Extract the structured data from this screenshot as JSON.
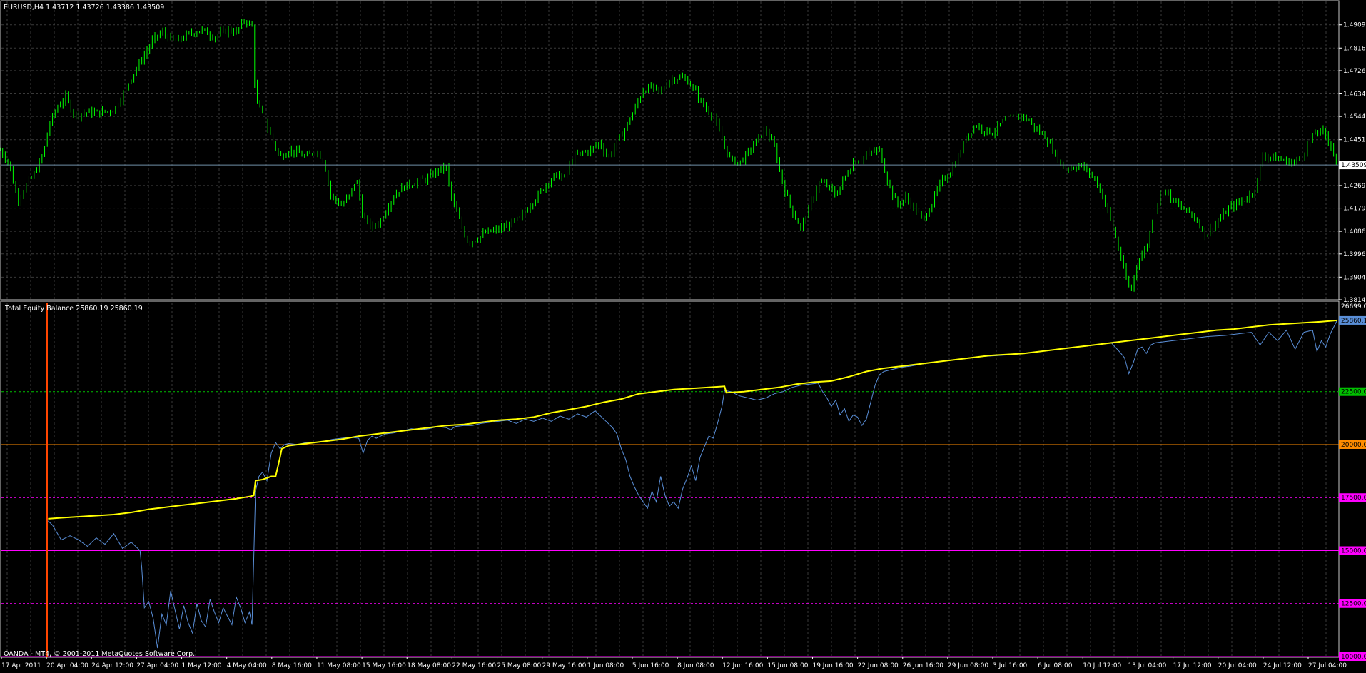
{
  "window": {
    "symbol_header": "EURUSD,H4  1.43712 1.43726 1.43386 1.43509",
    "indicator_header": "Total Equity Balance 25860.19 25860.19",
    "copyright": "OANDA - MT4, © 2001-2011 MetaQuotes Software Corp."
  },
  "colors": {
    "background": "#000000",
    "grid": "#3a3a3a",
    "candle": "#00ff00",
    "balance": "#ffff00",
    "equity": "#5a8fd8",
    "level_20000": "#ff8c00",
    "level_pink": "#ff00ff",
    "level_22500": "#00c000",
    "time_marker": "#ff4500",
    "current_price_line": "#6f8fa8"
  },
  "price_axis": {
    "ticks": [
      "1.49090",
      "1.48165",
      "1.47265",
      "1.46340",
      "1.45440",
      "1.44515",
      "1.42690",
      "1.41790",
      "1.40865",
      "1.39965",
      "1.39040",
      "1.38140"
    ],
    "current_price": "1.43509"
  },
  "indicator_axis": {
    "top_label": "26699.09",
    "ticks": [
      "25860.1",
      "22500.0",
      "20000.0",
      "17500.0",
      "15000.0",
      "12500.0",
      "10000.0"
    ]
  },
  "time_axis": {
    "labels": [
      "17 Apr 2011",
      "20 Apr 04:00",
      "24 Apr 12:00",
      "27 Apr 04:00",
      "1 May 12:00",
      "4 May 04:00",
      "8 May 16:00",
      "11 May 08:00",
      "15 May 16:00",
      "18 May 08:00",
      "22 May 16:00",
      "25 May 08:00",
      "29 May 16:00",
      "1 Jun 08:00",
      "5 Jun 16:00",
      "8 Jun 08:00",
      "12 Jun 16:00",
      "15 Jun 08:00",
      "19 Jun 16:00",
      "22 Jun 08:00",
      "26 Jun 16:00",
      "29 Jun 08:00",
      "3 Jul 16:00",
      "6 Jul 08:00",
      "10 Jul 12:00",
      "13 Jul 04:00",
      "17 Jul 12:00",
      "20 Jul 04:00",
      "24 Jul 12:00",
      "27 Jul 04:00"
    ]
  },
  "chart_data": [
    {
      "type": "candlestick",
      "title": "EURUSD,H4",
      "ylim": [
        1.3814,
        1.5002
      ],
      "price_path_keyframes": [
        [
          0,
          1.441
        ],
        [
          10,
          1.436
        ],
        [
          20,
          1.421
        ],
        [
          30,
          1.427
        ],
        [
          40,
          1.432
        ],
        [
          50,
          1.44
        ],
        [
          55,
          1.45
        ],
        [
          65,
          1.458
        ],
        [
          75,
          1.462
        ],
        [
          85,
          1.455
        ],
        [
          100,
          1.456
        ],
        [
          115,
          1.456
        ],
        [
          130,
          1.457
        ],
        [
          140,
          1.463
        ],
        [
          150,
          1.47
        ],
        [
          165,
          1.479
        ],
        [
          175,
          1.485
        ],
        [
          185,
          1.488
        ],
        [
          200,
          1.484
        ],
        [
          215,
          1.487
        ],
        [
          230,
          1.489
        ],
        [
          245,
          1.486
        ],
        [
          260,
          1.489
        ],
        [
          270,
          1.488
        ],
        [
          280,
          1.493
        ],
        [
          288,
          1.49
        ],
        [
          292,
          1.461
        ],
        [
          300,
          1.455
        ],
        [
          310,
          1.446
        ],
        [
          320,
          1.438
        ],
        [
          330,
          1.441
        ],
        [
          340,
          1.44
        ],
        [
          350,
          1.438
        ],
        [
          360,
          1.441
        ],
        [
          370,
          1.437
        ],
        [
          378,
          1.423
        ],
        [
          390,
          1.419
        ],
        [
          400,
          1.423
        ],
        [
          407,
          1.43
        ],
        [
          415,
          1.414
        ],
        [
          425,
          1.41
        ],
        [
          435,
          1.413
        ],
        [
          445,
          1.42
        ],
        [
          455,
          1.425
        ],
        [
          465,
          1.427
        ],
        [
          475,
          1.428
        ],
        [
          490,
          1.43
        ],
        [
          500,
          1.433
        ],
        [
          510,
          1.434
        ],
        [
          515,
          1.423
        ],
        [
          525,
          1.413
        ],
        [
          535,
          1.404
        ],
        [
          545,
          1.406
        ],
        [
          555,
          1.408
        ],
        [
          565,
          1.409
        ],
        [
          575,
          1.41
        ],
        [
          585,
          1.412
        ],
        [
          595,
          1.414
        ],
        [
          605,
          1.419
        ],
        [
          615,
          1.423
        ],
        [
          625,
          1.428
        ],
        [
          635,
          1.431
        ],
        [
          645,
          1.43
        ],
        [
          655,
          1.438
        ],
        [
          665,
          1.44
        ],
        [
          675,
          1.441
        ],
        [
          685,
          1.444
        ],
        [
          695,
          1.438
        ],
        [
          705,
          1.444
        ],
        [
          715,
          1.45
        ],
        [
          725,
          1.457
        ],
        [
          735,
          1.465
        ],
        [
          745,
          1.466
        ],
        [
          755,
          1.464
        ],
        [
          765,
          1.469
        ],
        [
          775,
          1.47
        ],
        [
          785,
          1.469
        ],
        [
          795,
          1.464
        ],
        [
          805,
          1.458
        ],
        [
          815,
          1.455
        ],
        [
          825,
          1.445
        ],
        [
          835,
          1.437
        ],
        [
          845,
          1.436
        ],
        [
          855,
          1.44
        ],
        [
          865,
          1.445
        ],
        [
          875,
          1.449
        ],
        [
          885,
          1.442
        ],
        [
          895,
          1.427
        ],
        [
          905,
          1.417
        ],
        [
          915,
          1.41
        ],
        [
          925,
          1.418
        ],
        [
          935,
          1.428
        ],
        [
          945,
          1.427
        ],
        [
          955,
          1.423
        ],
        [
          965,
          1.43
        ],
        [
          975,
          1.436
        ],
        [
          985,
          1.438
        ],
        [
          995,
          1.44
        ],
        [
          1005,
          1.441
        ],
        [
          1015,
          1.428
        ],
        [
          1025,
          1.419
        ],
        [
          1035,
          1.422
        ],
        [
          1045,
          1.418
        ],
        [
          1055,
          1.413
        ],
        [
          1065,
          1.42
        ],
        [
          1075,
          1.428
        ],
        [
          1085,
          1.432
        ],
        [
          1095,
          1.438
        ],
        [
          1105,
          1.447
        ],
        [
          1115,
          1.451
        ],
        [
          1125,
          1.449
        ],
        [
          1135,
          1.448
        ],
        [
          1145,
          1.452
        ],
        [
          1155,
          1.454
        ],
        [
          1165,
          1.455
        ],
        [
          1175,
          1.453
        ],
        [
          1185,
          1.449
        ],
        [
          1195,
          1.446
        ],
        [
          1205,
          1.44
        ],
        [
          1215,
          1.434
        ],
        [
          1225,
          1.434
        ],
        [
          1235,
          1.435
        ],
        [
          1245,
          1.432
        ],
        [
          1255,
          1.427
        ],
        [
          1265,
          1.418
        ],
        [
          1275,
          1.406
        ],
        [
          1285,
          1.392
        ],
        [
          1292,
          1.384
        ],
        [
          1300,
          1.397
        ],
        [
          1310,
          1.402
        ],
        [
          1320,
          1.418
        ],
        [
          1330,
          1.426
        ],
        [
          1340,
          1.421
        ],
        [
          1350,
          1.418
        ],
        [
          1360,
          1.416
        ],
        [
          1370,
          1.412
        ],
        [
          1378,
          1.407
        ],
        [
          1385,
          1.41
        ],
        [
          1395,
          1.414
        ],
        [
          1405,
          1.418
        ],
        [
          1415,
          1.42
        ],
        [
          1425,
          1.422
        ],
        [
          1435,
          1.426
        ],
        [
          1443,
          1.439
        ],
        [
          1455,
          1.438
        ],
        [
          1465,
          1.437
        ],
        [
          1475,
          1.436
        ],
        [
          1485,
          1.437
        ],
        [
          1495,
          1.443
        ],
        [
          1505,
          1.449
        ],
        [
          1515,
          1.447
        ],
        [
          1520,
          1.444
        ],
        [
          1528,
          1.435
        ]
      ]
    },
    {
      "type": "line",
      "title": "Total Equity Balance",
      "ylim": [
        10000,
        26699.09
      ],
      "series": [
        {
          "name": "Balance",
          "x": [
            55,
            70,
            90,
            110,
            130,
            150,
            170,
            190,
            210,
            230,
            250,
            270,
            285,
            290,
            292,
            300,
            310,
            315,
            320,
            322,
            330,
            350,
            370,
            390,
            410,
            430,
            450,
            470,
            490,
            510,
            530,
            550,
            570,
            590,
            610,
            630,
            650,
            670,
            690,
            710,
            730,
            750,
            770,
            790,
            810,
            828,
            830,
            850,
            870,
            890,
            910,
            930,
            950,
            970,
            990,
            1010,
            1030,
            1050,
            1070,
            1090,
            1110,
            1130,
            1150,
            1170,
            1190,
            1210,
            1230,
            1250,
            1270,
            1290,
            1310,
            1330,
            1350,
            1370,
            1390,
            1410,
            1430,
            1450,
            1470,
            1490,
            1510,
            1528
          ],
          "values": [
            16500,
            16550,
            16600,
            16650,
            16700,
            16800,
            16950,
            17050,
            17150,
            17250,
            17350,
            17450,
            17550,
            17600,
            18300,
            18350,
            18500,
            18500,
            19400,
            19800,
            19950,
            20050,
            20150,
            20250,
            20400,
            20500,
            20600,
            20700,
            20800,
            20900,
            20950,
            21050,
            21150,
            21200,
            21300,
            21500,
            21650,
            21800,
            22000,
            22150,
            22400,
            22500,
            22600,
            22650,
            22700,
            22750,
            22450,
            22500,
            22600,
            22700,
            22850,
            22950,
            23000,
            23200,
            23450,
            23600,
            23700,
            23800,
            23900,
            24000,
            24100,
            24200,
            24250,
            24300,
            24400,
            24500,
            24600,
            24700,
            24800,
            24900,
            25000,
            25100,
            25200,
            25300,
            25400,
            25450,
            25550,
            25650,
            25700,
            25750,
            25800,
            25860
          ]
        },
        {
          "name": "Equity",
          "x": [
            55,
            60,
            70,
            80,
            90,
            100,
            110,
            120,
            130,
            140,
            150,
            160,
            162,
            165,
            170,
            175,
            180,
            185,
            190,
            195,
            200,
            205,
            210,
            215,
            220,
            225,
            230,
            235,
            240,
            245,
            250,
            255,
            260,
            265,
            270,
            275,
            280,
            285,
            288,
            292,
            296,
            300,
            305,
            310,
            315,
            320,
            325,
            330,
            340,
            350,
            360,
            370,
            380,
            390,
            400,
            410,
            415,
            420,
            425,
            430,
            440,
            450,
            460,
            470,
            480,
            490,
            500,
            510,
            515,
            520,
            530,
            540,
            550,
            560,
            570,
            580,
            590,
            600,
            610,
            620,
            630,
            640,
            650,
            660,
            670,
            680,
            690,
            700,
            705,
            710,
            715,
            720,
            725,
            730,
            735,
            740,
            745,
            750,
            755,
            760,
            765,
            770,
            775,
            780,
            785,
            790,
            795,
            800,
            805,
            810,
            815,
            820,
            825,
            828,
            835,
            845,
            855,
            865,
            875,
            885,
            895,
            905,
            915,
            925,
            935,
            940,
            945,
            950,
            955,
            960,
            965,
            970,
            975,
            980,
            985,
            990,
            995,
            1000,
            1005,
            1010,
            1020,
            1030,
            1040,
            1060,
            1080,
            1100,
            1120,
            1140,
            1160,
            1180,
            1200,
            1220,
            1240,
            1260,
            1270,
            1280,
            1285,
            1290,
            1295,
            1300,
            1305,
            1310,
            1315,
            1320,
            1340,
            1360,
            1380,
            1400,
            1420,
            1430,
            1440,
            1450,
            1460,
            1470,
            1480,
            1490,
            1500,
            1505,
            1510,
            1515,
            1520,
            1528
          ],
          "values": [
            16400,
            16200,
            15500,
            15700,
            15500,
            15200,
            15600,
            15300,
            15800,
            15100,
            15400,
            15000,
            14200,
            12300,
            12600,
            11800,
            10400,
            12000,
            11500,
            13100,
            12200,
            11300,
            12400,
            11600,
            11100,
            12500,
            11700,
            11400,
            12700,
            12100,
            11600,
            12300,
            11900,
            11500,
            12800,
            12300,
            11600,
            12100,
            11500,
            17800,
            18500,
            18700,
            18300,
            19600,
            20100,
            19800,
            20000,
            20050,
            20000,
            20100,
            20100,
            20150,
            20250,
            20300,
            20350,
            20300,
            19600,
            20200,
            20400,
            20300,
            20500,
            20550,
            20650,
            20750,
            20700,
            20750,
            20850,
            20800,
            20700,
            20850,
            20900,
            20900,
            21000,
            21050,
            21100,
            21150,
            21000,
            21200,
            21100,
            21250,
            21100,
            21350,
            21200,
            21450,
            21300,
            21600,
            21200,
            20800,
            20500,
            19800,
            19300,
            18500,
            18000,
            17600,
            17300,
            17000,
            17800,
            17300,
            18500,
            17600,
            17100,
            17300,
            17000,
            17900,
            18400,
            19000,
            18300,
            19400,
            19900,
            20400,
            20300,
            21000,
            21800,
            22550,
            22500,
            22300,
            22200,
            22100,
            22200,
            22400,
            22500,
            22700,
            22800,
            22850,
            22900,
            22500,
            22200,
            21800,
            22100,
            21400,
            21700,
            21100,
            21400,
            21300,
            20900,
            21200,
            22000,
            22800,
            23300,
            23450,
            23550,
            23650,
            23700,
            23850,
            23950,
            24050,
            24150,
            24200,
            24250,
            24350,
            24450,
            24550,
            24650,
            24750,
            24800,
            24350,
            24100,
            23350,
            23850,
            24500,
            24600,
            24300,
            24700,
            24800,
            24900,
            25000,
            25100,
            25150,
            25250,
            25300,
            24700,
            25300,
            24900,
            25400,
            24500,
            25300,
            25400,
            24400,
            24900,
            24600,
            25200,
            25860
          ]
        }
      ],
      "levels": [
        22500,
        20000,
        17500,
        15000,
        12500,
        10000
      ]
    }
  ]
}
